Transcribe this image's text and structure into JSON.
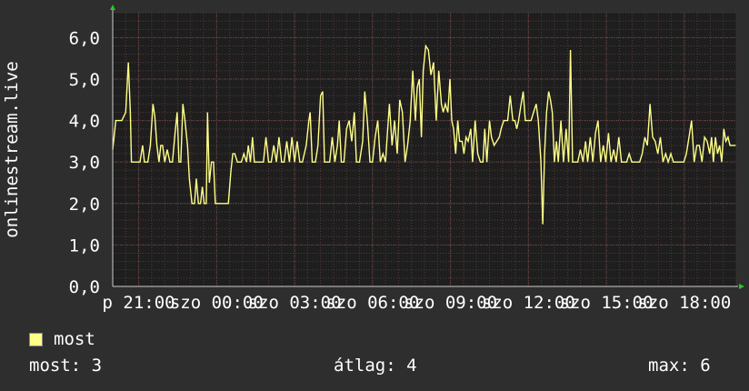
{
  "colors": {
    "background": "#2e2e2e",
    "plot_background": "#1e1e1e",
    "grid_minor": "#5a3a3a",
    "grid_major": "#6a4646",
    "axis": "#cccccc",
    "series": "#ffff88",
    "arrow": "#22cc22"
  },
  "chart_data": {
    "type": "line",
    "title": "",
    "ylabel": "onlinestream.live",
    "ylim": [
      0,
      6.6
    ],
    "y_ticks": [
      {
        "value": 0,
        "label": "0,0"
      },
      {
        "value": 1,
        "label": "1,0"
      },
      {
        "value": 2,
        "label": "2,0"
      },
      {
        "value": 3,
        "label": "3,0"
      },
      {
        "value": 4,
        "label": "4,0"
      },
      {
        "value": 5,
        "label": "5,0"
      },
      {
        "value": 6,
        "label": "6,0"
      }
    ],
    "x_range_hours": [
      0,
      24
    ],
    "x_ticks": [
      {
        "hour": 1,
        "label": "p 21:00"
      },
      {
        "hour": 4,
        "label": "szo 00:00"
      },
      {
        "hour": 7,
        "label": "szo 03:00"
      },
      {
        "hour": 10,
        "label": "szo 06:00"
      },
      {
        "hour": 13,
        "label": "szo 09:00"
      },
      {
        "hour": 16,
        "label": "szo 12:00"
      },
      {
        "hour": 19,
        "label": "szo 15:00"
      },
      {
        "hour": 22,
        "label": "szo 18:00"
      }
    ],
    "series": [
      {
        "name": "most",
        "color": "#ffff88",
        "points": [
          [
            0.0,
            3.3
          ],
          [
            0.12,
            4.0
          ],
          [
            0.35,
            4.0
          ],
          [
            0.5,
            4.2
          ],
          [
            0.6,
            5.4
          ],
          [
            0.68,
            4.2
          ],
          [
            0.72,
            3.0
          ],
          [
            0.95,
            3.0
          ],
          [
            1.05,
            3.0
          ],
          [
            1.15,
            3.4
          ],
          [
            1.22,
            3.0
          ],
          [
            1.35,
            3.0
          ],
          [
            1.45,
            3.4
          ],
          [
            1.55,
            4.4
          ],
          [
            1.62,
            4.1
          ],
          [
            1.7,
            3.4
          ],
          [
            1.78,
            3.0
          ],
          [
            1.85,
            3.4
          ],
          [
            1.92,
            3.4
          ],
          [
            2.0,
            3.0
          ],
          [
            2.1,
            3.3
          ],
          [
            2.2,
            3.0
          ],
          [
            2.3,
            3.0
          ],
          [
            2.4,
            3.7
          ],
          [
            2.48,
            4.2
          ],
          [
            2.55,
            3.0
          ],
          [
            2.62,
            3.0
          ],
          [
            2.7,
            4.4
          ],
          [
            2.78,
            4.0
          ],
          [
            2.88,
            3.4
          ],
          [
            2.95,
            2.6
          ],
          [
            3.05,
            2.0
          ],
          [
            3.15,
            2.0
          ],
          [
            3.22,
            2.6
          ],
          [
            3.3,
            2.0
          ],
          [
            3.38,
            2.0
          ],
          [
            3.45,
            2.4
          ],
          [
            3.52,
            2.0
          ],
          [
            3.6,
            2.0
          ],
          [
            3.65,
            4.2
          ],
          [
            3.72,
            2.5
          ],
          [
            3.8,
            3.0
          ],
          [
            3.88,
            3.0
          ],
          [
            3.95,
            2.0
          ],
          [
            4.05,
            2.0
          ],
          [
            4.15,
            2.0
          ],
          [
            4.25,
            2.0
          ],
          [
            4.45,
            2.0
          ],
          [
            4.55,
            2.8
          ],
          [
            4.62,
            3.2
          ],
          [
            4.7,
            3.2
          ],
          [
            4.8,
            3.0
          ],
          [
            4.95,
            3.0
          ],
          [
            5.05,
            3.2
          ],
          [
            5.15,
            3.0
          ],
          [
            5.22,
            3.4
          ],
          [
            5.3,
            3.0
          ],
          [
            5.38,
            3.6
          ],
          [
            5.45,
            3.0
          ],
          [
            5.6,
            3.0
          ],
          [
            5.7,
            3.0
          ],
          [
            5.8,
            3.0
          ],
          [
            5.9,
            3.6
          ],
          [
            6.0,
            3.0
          ],
          [
            6.1,
            3.0
          ],
          [
            6.2,
            3.4
          ],
          [
            6.3,
            3.0
          ],
          [
            6.4,
            3.6
          ],
          [
            6.5,
            3.0
          ],
          [
            6.6,
            3.0
          ],
          [
            6.7,
            3.5
          ],
          [
            6.8,
            3.0
          ],
          [
            6.9,
            3.6
          ],
          [
            7.0,
            3.0
          ],
          [
            7.1,
            3.5
          ],
          [
            7.2,
            3.0
          ],
          [
            7.3,
            3.0
          ],
          [
            7.45,
            3.4
          ],
          [
            7.55,
            4.0
          ],
          [
            7.6,
            4.2
          ],
          [
            7.68,
            3.0
          ],
          [
            7.8,
            3.0
          ],
          [
            7.9,
            3.4
          ],
          [
            8.0,
            4.6
          ],
          [
            8.08,
            4.7
          ],
          [
            8.15,
            3.0
          ],
          [
            8.25,
            3.0
          ],
          [
            8.35,
            3.0
          ],
          [
            8.45,
            3.6
          ],
          [
            8.55,
            3.0
          ],
          [
            8.65,
            3.4
          ],
          [
            8.72,
            4.0
          ],
          [
            8.8,
            3.0
          ],
          [
            8.9,
            3.0
          ],
          [
            9.0,
            3.8
          ],
          [
            9.1,
            4.0
          ],
          [
            9.2,
            3.5
          ],
          [
            9.3,
            4.2
          ],
          [
            9.38,
            3.0
          ],
          [
            9.5,
            3.0
          ],
          [
            9.62,
            3.5
          ],
          [
            9.7,
            4.7
          ],
          [
            9.8,
            4.0
          ],
          [
            9.9,
            3.0
          ],
          [
            10.0,
            3.0
          ],
          [
            10.1,
            3.6
          ],
          [
            10.2,
            4.0
          ],
          [
            10.3,
            3.0
          ],
          [
            10.4,
            3.2
          ],
          [
            10.5,
            3.0
          ],
          [
            10.55,
            3.5
          ],
          [
            10.65,
            4.4
          ],
          [
            10.75,
            3.4
          ],
          [
            10.85,
            4.0
          ],
          [
            10.95,
            3.2
          ],
          [
            11.05,
            4.5
          ],
          [
            11.15,
            4.2
          ],
          [
            11.25,
            3.0
          ],
          [
            11.35,
            3.4
          ],
          [
            11.45,
            4.0
          ],
          [
            11.55,
            5.2
          ],
          [
            11.65,
            4.0
          ],
          [
            11.72,
            4.8
          ],
          [
            11.8,
            5.0
          ],
          [
            11.88,
            3.6
          ],
          [
            11.95,
            5.2
          ],
          [
            12.05,
            5.8
          ],
          [
            12.15,
            5.7
          ],
          [
            12.25,
            5.1
          ],
          [
            12.35,
            5.4
          ],
          [
            12.45,
            4.0
          ],
          [
            12.55,
            5.2
          ],
          [
            12.65,
            4.4
          ],
          [
            12.72,
            4.2
          ],
          [
            12.8,
            4.4
          ],
          [
            12.9,
            4.2
          ],
          [
            12.98,
            5.0
          ],
          [
            13.05,
            4.0
          ],
          [
            13.12,
            3.8
          ],
          [
            13.2,
            3.2
          ],
          [
            13.28,
            4.0
          ],
          [
            13.35,
            3.5
          ],
          [
            13.45,
            3.5
          ],
          [
            13.52,
            3.2
          ],
          [
            13.6,
            3.6
          ],
          [
            13.68,
            3.5
          ],
          [
            13.78,
            3.8
          ],
          [
            13.85,
            3.0
          ],
          [
            13.95,
            4.0
          ],
          [
            14.05,
            3.2
          ],
          [
            14.15,
            3.0
          ],
          [
            14.25,
            3.0
          ],
          [
            14.32,
            3.8
          ],
          [
            14.4,
            3.0
          ],
          [
            14.5,
            4.0
          ],
          [
            14.58,
            3.6
          ],
          [
            14.68,
            3.4
          ],
          [
            14.78,
            3.5
          ],
          [
            14.88,
            3.6
          ],
          [
            14.95,
            3.8
          ],
          [
            15.05,
            4.0
          ],
          [
            15.2,
            4.0
          ],
          [
            15.3,
            4.6
          ],
          [
            15.4,
            4.0
          ],
          [
            15.48,
            4.0
          ],
          [
            15.55,
            3.8
          ],
          [
            15.62,
            4.0
          ],
          [
            15.72,
            4.4
          ],
          [
            15.8,
            4.7
          ],
          [
            15.88,
            4.0
          ],
          [
            15.98,
            4.0
          ],
          [
            16.1,
            4.0
          ],
          [
            16.2,
            4.2
          ],
          [
            16.3,
            4.4
          ],
          [
            16.38,
            4.0
          ],
          [
            16.48,
            3.0
          ],
          [
            16.55,
            1.5
          ],
          [
            16.62,
            3.2
          ],
          [
            16.7,
            4.2
          ],
          [
            16.78,
            4.7
          ],
          [
            16.85,
            4.5
          ],
          [
            16.92,
            4.2
          ],
          [
            17.0,
            3.0
          ],
          [
            17.08,
            3.5
          ],
          [
            17.15,
            3.0
          ],
          [
            17.25,
            4.0
          ],
          [
            17.35,
            3.0
          ],
          [
            17.45,
            3.8
          ],
          [
            17.55,
            3.0
          ],
          [
            17.62,
            5.7
          ],
          [
            17.7,
            3.0
          ],
          [
            17.8,
            3.0
          ],
          [
            17.9,
            3.0
          ],
          [
            18.0,
            3.3
          ],
          [
            18.1,
            3.0
          ],
          [
            18.2,
            3.5
          ],
          [
            18.28,
            3.0
          ],
          [
            18.38,
            3.6
          ],
          [
            18.48,
            3.0
          ],
          [
            18.58,
            3.7
          ],
          [
            18.68,
            4.0
          ],
          [
            18.78,
            3.0
          ],
          [
            18.88,
            3.4
          ],
          [
            18.98,
            3.0
          ],
          [
            19.08,
            3.7
          ],
          [
            19.18,
            3.0
          ],
          [
            19.28,
            3.3
          ],
          [
            19.38,
            3.0
          ],
          [
            19.48,
            3.6
          ],
          [
            19.58,
            3.0
          ],
          [
            19.68,
            3.0
          ],
          [
            19.78,
            3.0
          ],
          [
            19.88,
            3.2
          ],
          [
            19.98,
            3.0
          ],
          [
            20.08,
            3.0
          ],
          [
            20.18,
            3.0
          ],
          [
            20.28,
            3.0
          ],
          [
            20.38,
            3.2
          ],
          [
            20.48,
            3.6
          ],
          [
            20.58,
            3.4
          ],
          [
            20.68,
            4.4
          ],
          [
            20.78,
            3.6
          ],
          [
            20.88,
            3.5
          ],
          [
            20.98,
            3.2
          ],
          [
            21.08,
            3.6
          ],
          [
            21.18,
            3.0
          ],
          [
            21.28,
            3.2
          ],
          [
            21.38,
            3.0
          ],
          [
            21.48,
            3.2
          ],
          [
            21.58,
            3.0
          ],
          [
            21.68,
            3.0
          ],
          [
            21.78,
            3.0
          ],
          [
            21.88,
            3.0
          ],
          [
            21.98,
            3.0
          ],
          [
            22.08,
            3.2
          ],
          [
            22.18,
            3.6
          ],
          [
            22.28,
            4.0
          ],
          [
            22.38,
            3.0
          ],
          [
            22.48,
            3.4
          ],
          [
            22.58,
            3.4
          ],
          [
            22.68,
            3.0
          ],
          [
            22.78,
            3.6
          ],
          [
            22.88,
            3.5
          ],
          [
            22.98,
            3.2
          ],
          [
            23.05,
            3.6
          ],
          [
            23.12,
            3.0
          ],
          [
            23.2,
            3.6
          ],
          [
            23.28,
            3.2
          ],
          [
            23.36,
            3.4
          ],
          [
            23.44,
            3.0
          ],
          [
            23.52,
            3.8
          ],
          [
            23.6,
            3.5
          ],
          [
            23.68,
            3.6
          ],
          [
            23.76,
            3.4
          ],
          [
            23.84,
            3.4
          ],
          [
            23.92,
            3.4
          ],
          [
            23.98,
            3.4
          ]
        ]
      }
    ]
  },
  "legend": {
    "label": "most"
  },
  "stats": {
    "now": "most: 3",
    "avg": "átlag: 4",
    "max": "max: 6"
  }
}
